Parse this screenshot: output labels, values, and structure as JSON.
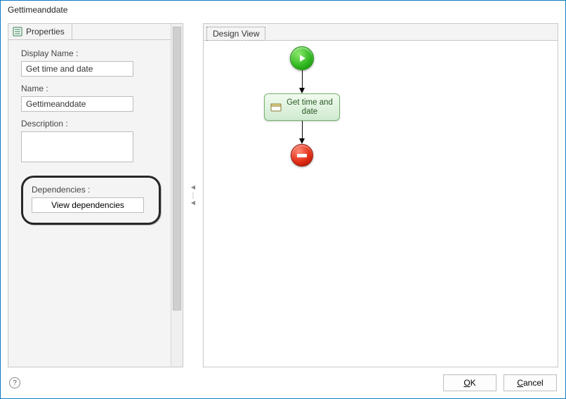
{
  "window": {
    "title": "Gettimeanddate"
  },
  "tabs": {
    "properties": "Properties",
    "design_view": "Design View"
  },
  "form": {
    "display_name_label": "Display Name :",
    "display_name_value": "Get time and date",
    "name_label": "Name :",
    "name_value": "Gettimeanddate",
    "description_label": "Description :",
    "description_value": "",
    "dependencies_label": "Dependencies :",
    "view_dependencies_btn": "View dependencies"
  },
  "flow": {
    "task_label": "Get time and date"
  },
  "buttons": {
    "ok_underline": "O",
    "ok_rest": "K",
    "cancel_underline": "C",
    "cancel_rest": "ancel",
    "help": "?"
  }
}
